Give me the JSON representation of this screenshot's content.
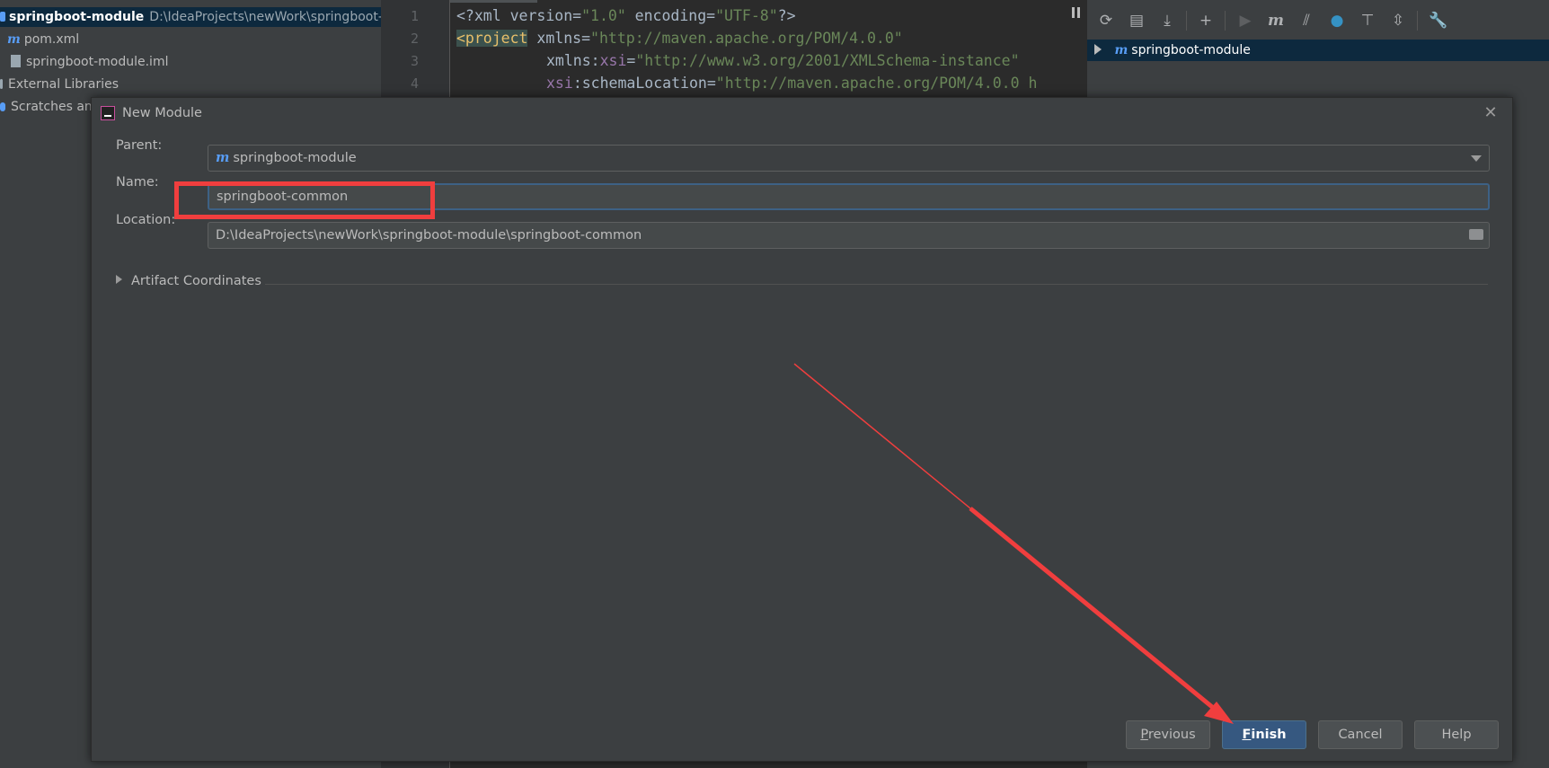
{
  "project_tree": {
    "root_label": "springboot-module",
    "root_path": "D:\\IdeaProjects\\newWork\\springboot-m",
    "items": [
      {
        "label": "pom.xml",
        "icon": "maven-icon"
      },
      {
        "label": "springboot-module.iml",
        "icon": "file-icon"
      },
      {
        "label": "External Libraries",
        "icon": "library-icon"
      },
      {
        "label": "Scratches and",
        "icon": "scratches-icon"
      }
    ]
  },
  "editor": {
    "line_numbers": [
      "1",
      "2",
      "3",
      "4"
    ],
    "line1": {
      "a": "<?xml version=",
      "b": "\"1.0\"",
      "c": " encoding=",
      "d": "\"UTF-8\"",
      "e": "?>"
    },
    "line2": {
      "tag": "<project",
      "attr": " xmlns=",
      "val": "\"http://maven.apache.org/POM/4.0.0\""
    },
    "line3": {
      "ns": "xmlns:",
      "attr": "xsi",
      "eq": "=",
      "val": "\"http://www.w3.org/2001/XMLSchema-instance\""
    },
    "line4": {
      "ns": "xsi",
      "attr": ":schemaLocation=",
      "val": "\"http://maven.apache.org/POM/4.0.0 h"
    }
  },
  "maven_panel": {
    "project_label": "springboot-module"
  },
  "dialog": {
    "title": "New Module",
    "parent_label": "Parent:",
    "parent_value": "springboot-module",
    "name_label": "Name:",
    "name_value": "springboot-common",
    "location_label": "Location:",
    "location_value": "D:\\IdeaProjects\\newWork\\springboot-module\\springboot-common",
    "artifact_label": "Artifact Coordinates",
    "buttons": {
      "previous_prefix": "P",
      "previous_rest": "revious",
      "finish_prefix": "F",
      "finish_rest": "inish",
      "cancel": "Cancel",
      "help": "Help"
    }
  },
  "colors": {
    "annotation_red": "#f03e3e",
    "default_button": "#365880",
    "selection": "#0d293e"
  }
}
